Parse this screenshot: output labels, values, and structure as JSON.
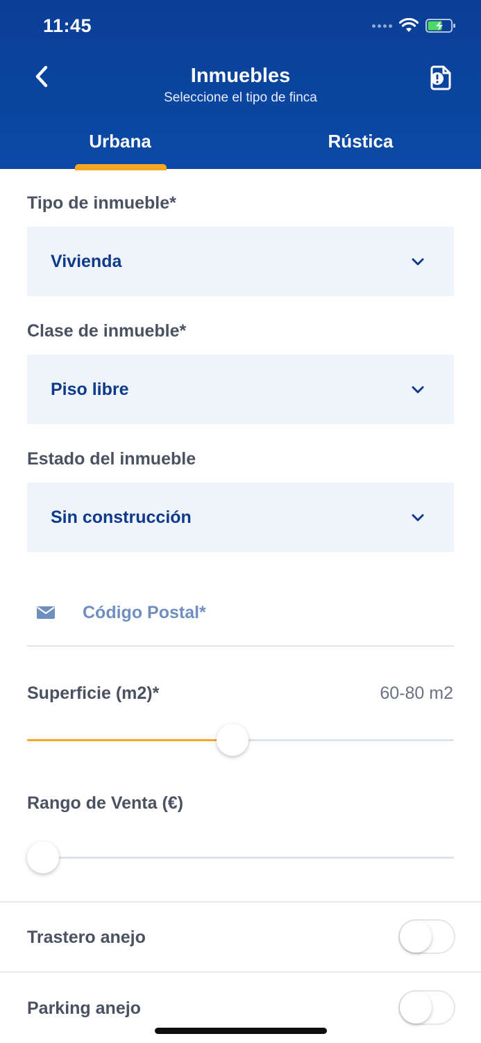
{
  "status_bar": {
    "time": "11:45"
  },
  "header": {
    "title": "Inmuebles",
    "subtitle": "Seleccione el tipo de finca",
    "back_icon": "chevron-left-icon",
    "doc_icon": "document-alert-icon"
  },
  "tabs": [
    {
      "label": "Urbana",
      "selected": true
    },
    {
      "label": "Rústica",
      "selected": false
    }
  ],
  "form": {
    "tipo": {
      "label": "Tipo de inmueble*",
      "value": "Vivienda"
    },
    "clase": {
      "label": "Clase de inmueble*",
      "value": "Piso libre"
    },
    "estado": {
      "label": "Estado del inmueble",
      "value": "Sin construcción"
    },
    "postal": {
      "placeholder": "Código Postal*",
      "value": ""
    },
    "superficie": {
      "label": "Superficie (m2)*",
      "value_text": "60-80 m2",
      "position": 0.48
    },
    "rango": {
      "label": "Rango de Venta (€)",
      "position": 0.0
    },
    "trastero": {
      "label": "Trastero anejo",
      "on": false
    },
    "parking": {
      "label": "Parking anejo",
      "on": false
    }
  },
  "colors": {
    "header": "#0b3e96",
    "accent": "#f5a623",
    "select_bg": "#eff4fa",
    "select_text": "#0d3a8a",
    "label_text": "#4a5160"
  }
}
